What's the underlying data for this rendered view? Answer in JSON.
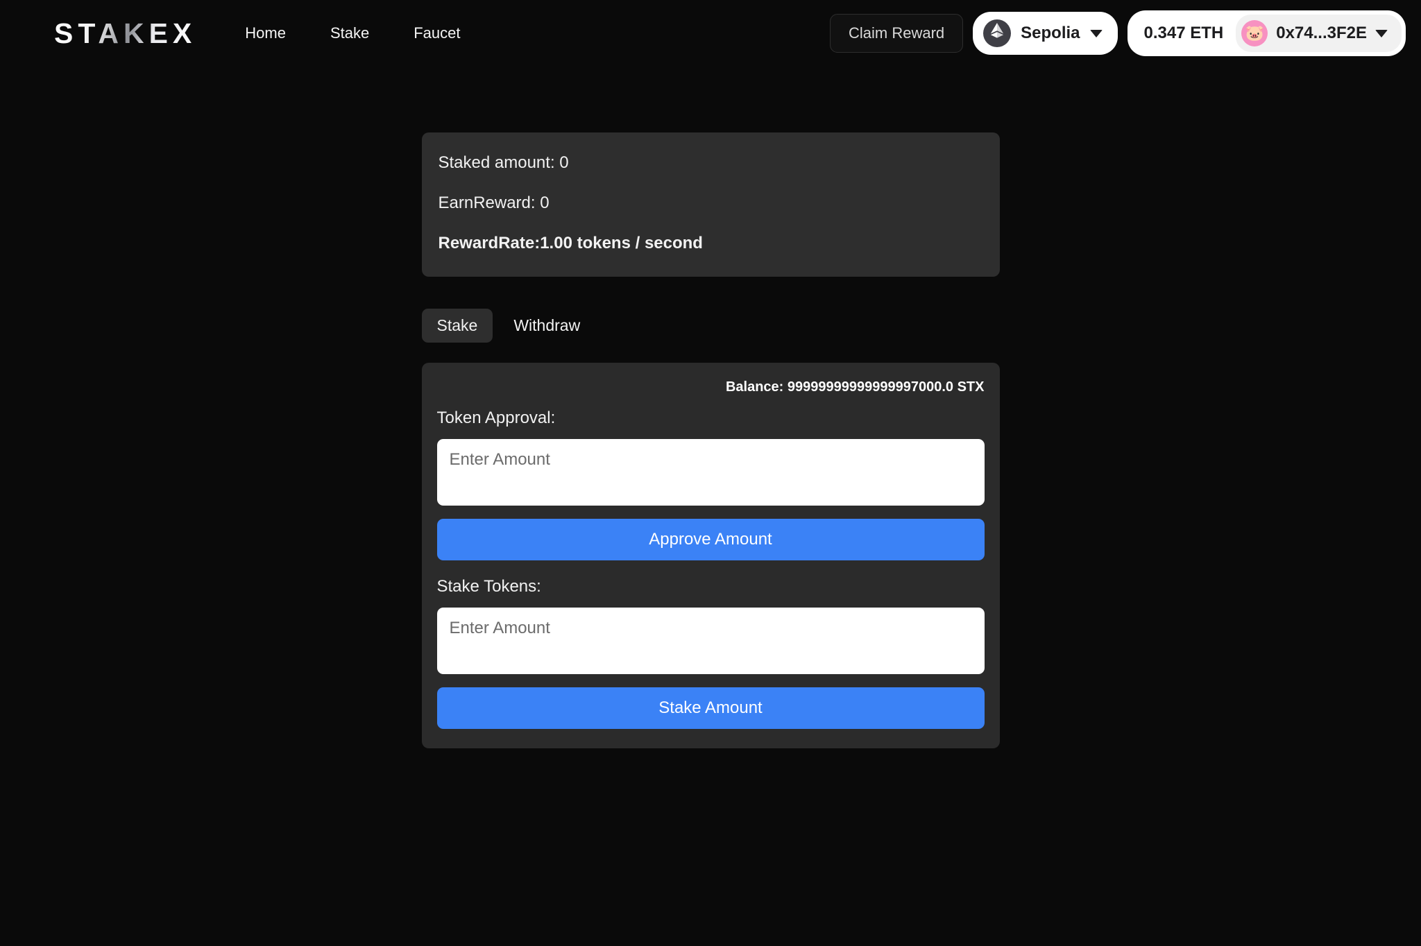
{
  "brand": {
    "logo_text": "STAKEX"
  },
  "nav": {
    "items": [
      {
        "label": "Home"
      },
      {
        "label": "Stake"
      },
      {
        "label": "Faucet"
      }
    ]
  },
  "header": {
    "claim_label": "Claim Reward",
    "network": {
      "name": "Sepolia",
      "icon": "ethereum-icon",
      "chevron": "chevron-down-icon"
    },
    "account": {
      "eth_balance": "0.347 ETH",
      "address": "0x74...3F2E",
      "avatar_emoji": "🐷",
      "avatar_color": "#f791c1",
      "chevron": "chevron-down-icon"
    }
  },
  "stats": {
    "staked_amount": "Staked amount: 0",
    "earn_reward": "EarnReward: 0",
    "reward_rate": "RewardRate:1.00 tokens / second"
  },
  "tabs": [
    {
      "label": "Stake",
      "active": true
    },
    {
      "label": "Withdraw",
      "active": false
    }
  ],
  "form": {
    "balance": "Balance: 99999999999999997000.0 STX",
    "approval": {
      "label": "Token Approval:",
      "placeholder": "Enter Amount",
      "value": "",
      "button": "Approve Amount"
    },
    "stake": {
      "label": "Stake Tokens:",
      "placeholder": "Enter Amount",
      "value": "",
      "button": "Stake Amount"
    }
  },
  "colors": {
    "background": "#0a0a0a",
    "card": "#2e2e2e",
    "accent": "#3b82f6"
  }
}
